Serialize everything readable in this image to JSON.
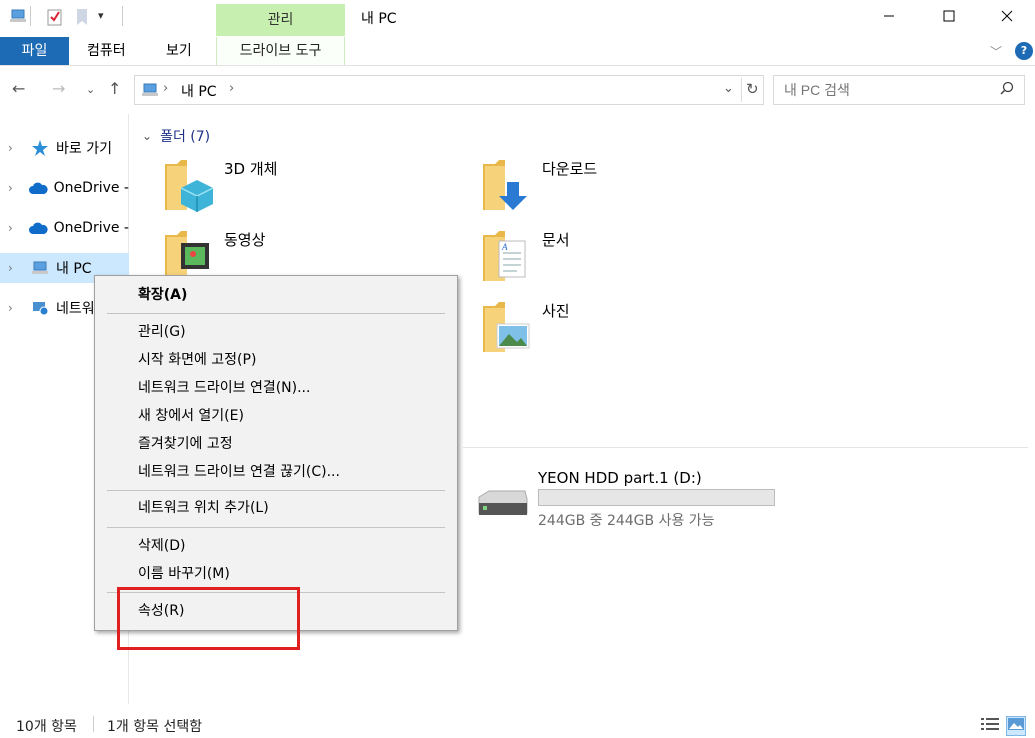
{
  "window": {
    "title": "내 PC",
    "context_tab": "관리",
    "controls": [
      "minimize-icon",
      "maximize-icon",
      "close-icon"
    ]
  },
  "ribbon": {
    "tabs": [
      "파일",
      "컴퓨터",
      "보기",
      "드라이브 도구"
    ],
    "accent": "#1d6ab5"
  },
  "address": {
    "path": [
      "내 PC"
    ],
    "search_placeholder": "내 PC 검색"
  },
  "navpane": {
    "items": [
      {
        "label": "바로 가기",
        "icon": "star-icon"
      },
      {
        "label": "OneDrive -",
        "icon": "onedrive-cloud-icon"
      },
      {
        "label": "OneDrive -",
        "icon": "onedrive-cloud-icon"
      },
      {
        "label": "내 PC",
        "icon": "pc-icon",
        "selected": true
      },
      {
        "label": "네트워",
        "icon": "network-icon"
      }
    ]
  },
  "content": {
    "group_header": "폴더 (7)",
    "folders": [
      {
        "name": "3D 개체",
        "icon": "3d-objects-folder-icon"
      },
      {
        "name": "다운로드",
        "icon": "downloads-folder-icon"
      },
      {
        "name": "동영상",
        "icon": "videos-folder-icon"
      },
      {
        "name": "문서",
        "icon": "documents-folder-icon"
      },
      {
        "name": "사진",
        "icon": "pictures-folder-icon"
      }
    ],
    "drive": {
      "name": "YEON HDD part.1 (D:)",
      "free_text": "244GB 중 244GB 사용 가능",
      "used_fraction": 0.0
    }
  },
  "context_menu": {
    "items": [
      {
        "label": "확장(A)",
        "bold": true
      },
      {
        "label": "관리(G)"
      },
      {
        "label": "시작 화면에 고정(P)"
      },
      {
        "label": "네트워크 드라이브 연결(N)..."
      },
      {
        "label": "새 창에서 열기(E)"
      },
      {
        "label": "즐겨찾기에 고정"
      },
      {
        "label": "네트워크 드라이브 연결 끊기(C)..."
      },
      {
        "label": "네트워크 위치 추가(L)"
      },
      {
        "label": "삭제(D)"
      },
      {
        "label": "이름 바꾸기(M)"
      },
      {
        "label": "속성(R)"
      }
    ],
    "highlighted_item": "속성(R)",
    "highlight_color": "#e02020"
  },
  "statusbar": {
    "count": "10개 항목",
    "selection": "1개 항목 선택함"
  }
}
